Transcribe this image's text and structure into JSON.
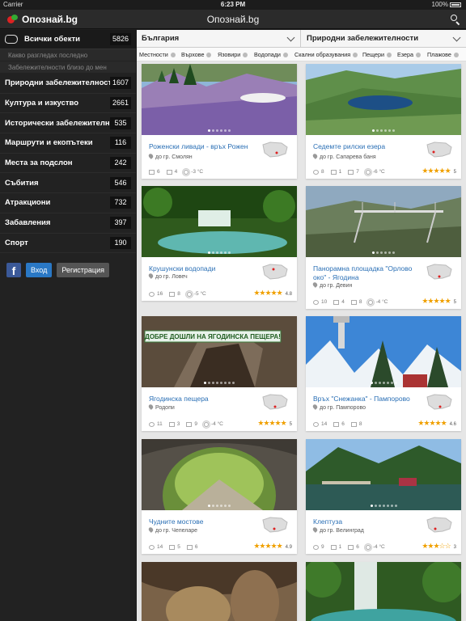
{
  "status": {
    "carrier": "Carrier",
    "time": "6:23 PM",
    "battery": "100%"
  },
  "navbar": {
    "brand": "Опознай.bg",
    "title": "Опознай.bg"
  },
  "sidebar": {
    "all": {
      "label": "Всички обекти",
      "count": "5826"
    },
    "sub": [
      "Какво разгледах последно",
      "Забележителности близо до мен"
    ],
    "items": [
      {
        "label": "Природни забележителности",
        "count": "1607"
      },
      {
        "label": "Култура и изкуство",
        "count": "2661"
      },
      {
        "label": "Исторически забележителности",
        "count": "535"
      },
      {
        "label": "Маршрути и екопътеки",
        "count": "116"
      },
      {
        "label": "Места за подслон",
        "count": "242"
      },
      {
        "label": "Събития",
        "count": "546"
      },
      {
        "label": "Атракциони",
        "count": "732"
      },
      {
        "label": "Забавления",
        "count": "397"
      },
      {
        "label": "Спорт",
        "count": "190"
      }
    ],
    "auth": {
      "fb": "f",
      "login": "Вход",
      "register": "Регистрация"
    }
  },
  "selectors": {
    "region": "България",
    "category": "Природни забележителности"
  },
  "tabs": [
    "Местности",
    "Върхове",
    "Язовири",
    "Водопади",
    "Скални образувания",
    "Пещери",
    "Езера",
    "Плажове"
  ],
  "cards": [
    {
      "title": "Роженски ливади - връх Рожен",
      "location": "до гр. Смолян",
      "stats": [
        "6",
        "4",
        "-3 °C"
      ],
      "stars": "",
      "rating": ""
    },
    {
      "title": "Седемте рилски езера",
      "location": "до гр. Сапарева баня",
      "stats": [
        "8",
        "1",
        "7",
        "-6 °C"
      ],
      "stars": "★★★★★",
      "rating": "5"
    },
    {
      "title": "Крушунски водопади",
      "location": "до гр. Ловеч",
      "stats": [
        "16",
        "8",
        "-5 °C"
      ],
      "stars": "★★★★★",
      "rating": "4.8"
    },
    {
      "title": "Панорамна площадка \"Орлово око\" - Ягодина",
      "location": "до гр. Девин",
      "stats": [
        "10",
        "4",
        "8",
        "-4 °C"
      ],
      "stars": "★★★★★",
      "rating": "5"
    },
    {
      "title": "Ягодинска пещера",
      "location": "Родопи",
      "stats": [
        "11",
        "3",
        "9",
        "-4 °C"
      ],
      "stars": "★★★★★",
      "rating": "5"
    },
    {
      "title": "Връх \"Снежанка\" - Пампорово",
      "location": "до гр. Пампорово",
      "stats": [
        "14",
        "6",
        "8"
      ],
      "stars": "★★★★★",
      "rating": "4.6"
    },
    {
      "title": "Чудните мостове",
      "location": "до гр. Чепеларе",
      "stats": [
        "14",
        "5",
        "6"
      ],
      "stars": "★★★★★",
      "rating": "4.9"
    },
    {
      "title": "Клептуза",
      "location": "до гр. Велинград",
      "stats": [
        "9",
        "1",
        "6",
        "-4 °C"
      ],
      "stars": "★★★☆☆",
      "rating": "3"
    }
  ],
  "banner": "ДОБРЕ ДОШЛИ НА ЯГОДИНСКА ПЕЩЕРА!",
  "colors": {
    "link": "#2a6fb5",
    "star": "#f0a000",
    "login": "#2a78c5",
    "facebook": "#3b5998"
  }
}
